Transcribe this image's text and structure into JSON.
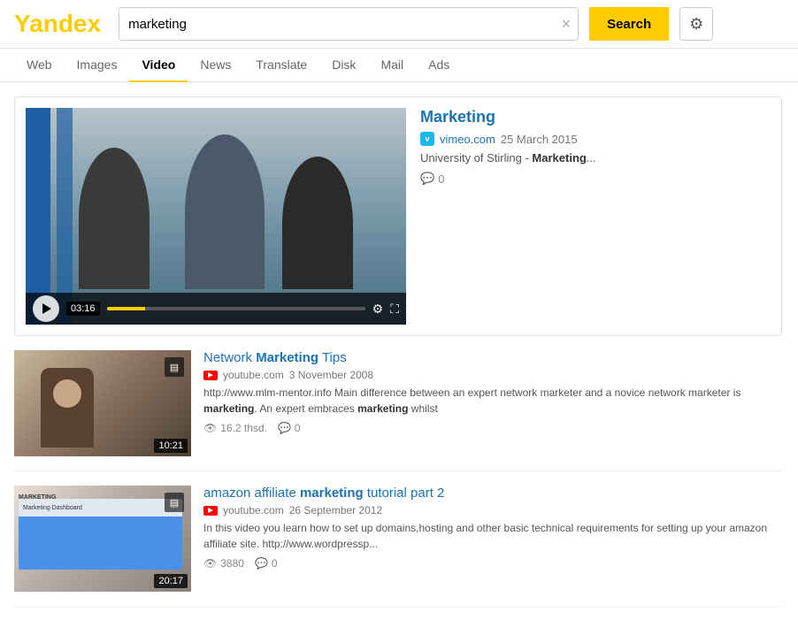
{
  "logo": {
    "y": "Y",
    "rest": "andex"
  },
  "header": {
    "search_value": "marketing",
    "search_placeholder": "Search",
    "search_button_label": "Search",
    "clear_button_label": "×"
  },
  "nav": {
    "tabs": [
      {
        "id": "web",
        "label": "Web",
        "active": false
      },
      {
        "id": "images",
        "label": "Images",
        "active": false
      },
      {
        "id": "video",
        "label": "Video",
        "active": true
      },
      {
        "id": "news",
        "label": "News",
        "active": false
      },
      {
        "id": "translate",
        "label": "Translate",
        "active": false
      },
      {
        "id": "disk",
        "label": "Disk",
        "active": false
      },
      {
        "id": "mail",
        "label": "Mail",
        "active": false
      },
      {
        "id": "ads",
        "label": "Ads",
        "active": false
      }
    ]
  },
  "results": {
    "featured": {
      "title": "Marketing",
      "source_icon": "vimeo",
      "source_name": "vimeo.com",
      "source_date": "25 March 2015",
      "description": "University of Stirling - ",
      "description_bold": "Marketing",
      "description_suffix": "...",
      "duration": "03:16",
      "comments": "0"
    },
    "items": [
      {
        "title_prefix": "Network ",
        "title_bold": "Marketing",
        "title_suffix": " Tips",
        "source_icon": "youtube",
        "source_name": "youtube.com",
        "source_date": "3 November 2008",
        "description": "http://www.mlm-mentor.info Main difference between an expert network marketer and a novice network marketer is ",
        "desc_bold1": "marketing",
        "desc_mid": ". An expert embraces ",
        "desc_bold2": "marketing",
        "desc_end": " whilst",
        "views": "16.2 thsd.",
        "comments": "0",
        "duration": "10:21"
      },
      {
        "title_prefix": "amazon affiliate ",
        "title_bold": "marketing",
        "title_suffix": " tutorial part 2",
        "source_icon": "youtube",
        "source_name": "youtube.com",
        "source_date": "26 September 2012",
        "description": "In this video you learn how to set up domains,hosting and other basic technical requirements for setting up your amazon affiliate site. http://www.wordpressp...",
        "views": "3880",
        "comments": "0",
        "duration": "20:17"
      }
    ]
  }
}
